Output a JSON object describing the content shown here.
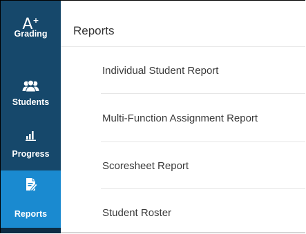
{
  "sidebar": {
    "items": [
      {
        "label": "Grading",
        "icon": "a-plus-icon",
        "glyph": "A"
      },
      {
        "label": "Students",
        "icon": "users-icon"
      },
      {
        "label": "Progress",
        "icon": "bar-chart-icon"
      },
      {
        "label": "Reports",
        "icon": "edit-document-icon",
        "active": true
      }
    ]
  },
  "main": {
    "title": "Reports",
    "reports": [
      "Individual Student Report",
      "Multi-Function Assignment Report",
      "Scoresheet Report",
      "Student Roster"
    ]
  },
  "colors": {
    "sidebar": "#16486b",
    "sidebar_active": "#1a8ad0",
    "text": "#333333"
  }
}
